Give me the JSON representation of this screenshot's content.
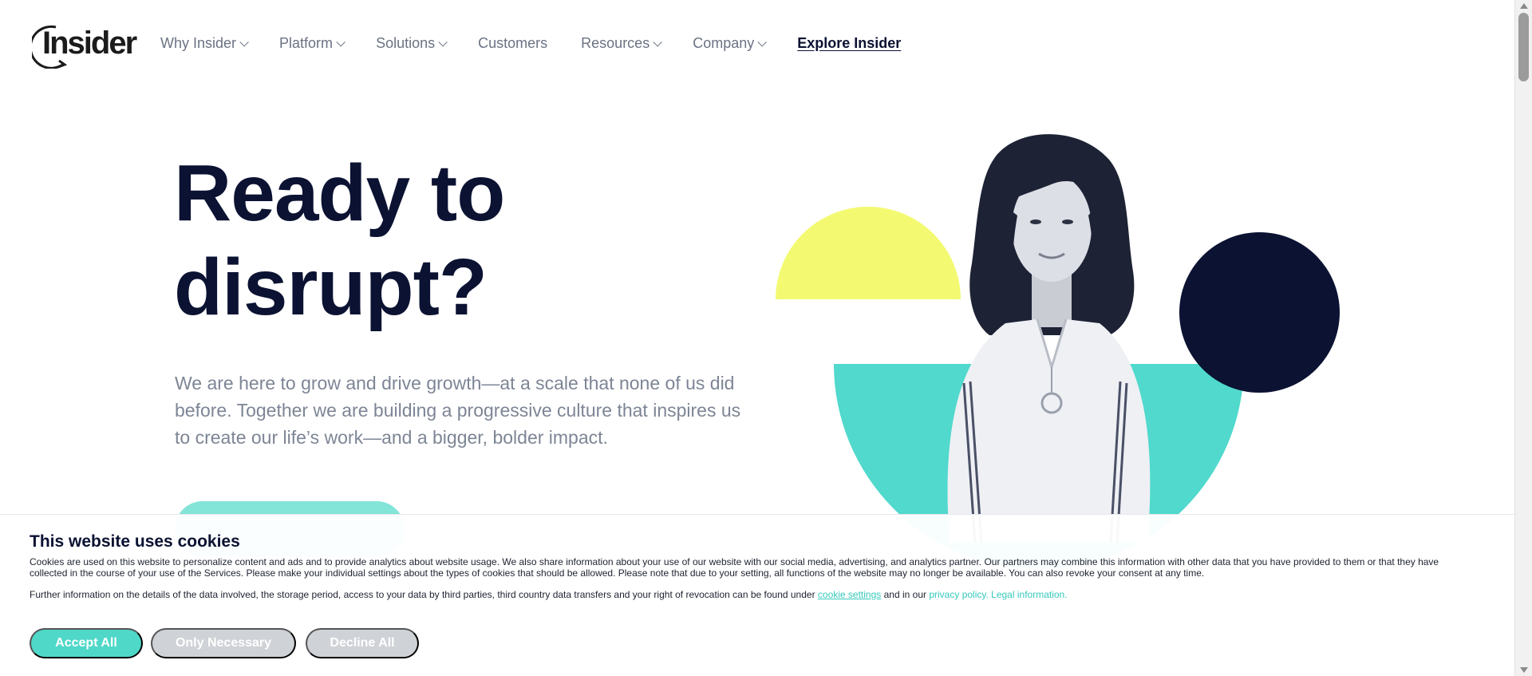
{
  "brand": {
    "name": "Insider"
  },
  "nav": {
    "items": [
      {
        "label": "Why Insider",
        "has_dropdown": true
      },
      {
        "label": "Platform",
        "has_dropdown": true
      },
      {
        "label": "Solutions",
        "has_dropdown": true
      },
      {
        "label": "Customers",
        "has_dropdown": false
      },
      {
        "label": "Resources",
        "has_dropdown": true
      },
      {
        "label": "Company",
        "has_dropdown": true
      }
    ],
    "explore_label": "Explore Insider"
  },
  "hero": {
    "title_line1": "Ready to",
    "title_line2": "disrupt?",
    "subtitle": "We are here to grow and drive growth—at a scale that none of us did before. Together we are building a progressive culture that inspires us to create our life’s work—and a bigger, bolder impact."
  },
  "cookie": {
    "title": "This website uses cookies",
    "paragraph1": "Cookies are used on this website to personalize content and ads and to provide analytics about website usage. We also share information about your use of our website with our social media, advertising, and analytics partner. Our partners may combine this information with other data that you have provided to them or that they have collected in the course of your use of the Services. Please make your individual settings about the types of cookies that should be allowed. Please note that due to your setting, all functions of the website may no longer be available. You can also revoke your consent at any time.",
    "paragraph2_prefix": "Further information on the details of the data involved, the storage period, access to your data by third parties, third country data transfers and your right of revocation can be found under ",
    "settings_link": "cookie settings",
    "paragraph2_middle": " and in our ",
    "privacy_link": "privacy policy.",
    "legal_link": "Legal information.",
    "accept_label": "Accept All",
    "necessary_label": "Only Necessary",
    "decline_label": "Decline All"
  },
  "colors": {
    "navy": "#0b1232",
    "teal": "#4fd8c8",
    "yellow": "#f3fa72",
    "muted_text": "#7d8595",
    "disabled_button": "#cfd2d6"
  },
  "icons": {
    "logo": "insider-logo-icon",
    "dropdown": "chevron-down-icon"
  }
}
